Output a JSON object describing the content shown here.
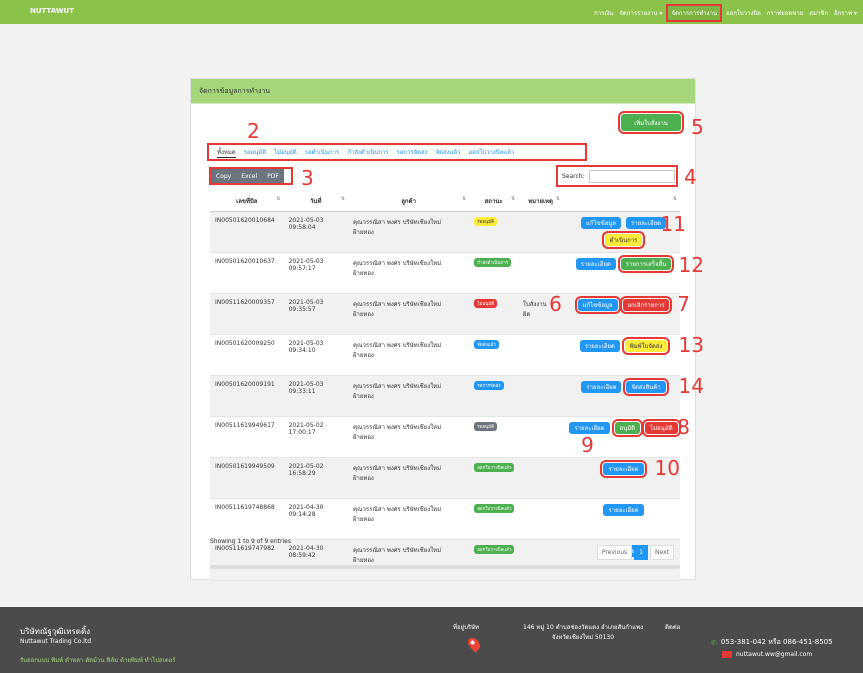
{
  "brand": "NUTTAWUT",
  "nav": [
    {
      "label": "การเงิน"
    },
    {
      "label": "จัดการรายงาน ▾"
    },
    {
      "label": "จัดการการทำงาน"
    },
    {
      "label": "ออกใบวางบิล"
    },
    {
      "label": "กราฟยอดขาย"
    },
    {
      "label": "สมาชิก"
    },
    {
      "label": "อีกราฟ ▾"
    }
  ],
  "card": {
    "title": "จัดการข้อมูลการทำงาน",
    "add_button": "เพิ่มใบสั่งงาน",
    "tabs": [
      "ทั้งหมด",
      "รออนุมัติ",
      "ไม่อนุมัติ",
      "รอดำเนินการ",
      "กำลังดำเนินการ",
      "รอการจัดส่ง",
      "จัดส่งแล้ว",
      "ออกใบวางบิลแล้ว"
    ],
    "export_buttons": [
      "Copy",
      "Excel",
      "PDF"
    ],
    "search_label": "Search:",
    "columns": [
      "เลขที่บิล",
      "วันที่",
      "ลูกค้า",
      "สถานะ",
      "หมายเหตุ",
      ""
    ],
    "rows": [
      {
        "bill": "IN00501620010684",
        "date1": "2021-05-03",
        "date2": "09:58:04",
        "customer": "คุณวรรณิสา พงศร บริษัทเชียงใหม่",
        "customer2": "ฝ้ายทอง",
        "status": "รออนุมัติ",
        "note": ""
      },
      {
        "bill": "IN00501620010637",
        "date1": "2021-05-03",
        "date2": "09:57:17",
        "customer": "คุณวรรณิสา พงศร บริษัทเชียงใหม่",
        "customer2": "ฝ้ายทอง",
        "status": "กำลังดำเนินการ",
        "note": ""
      },
      {
        "bill": "IN00511620009357",
        "date1": "2021-05-03",
        "date2": "09:35:57",
        "customer": "คุณวรรณิสา พงศร บริษัทเชียงใหม่",
        "customer2": "ฝ้ายทอง",
        "status": "ไม่อนุมัติ",
        "note": "ใบสั่งงาน",
        "note2": "ผิด"
      },
      {
        "bill": "IN00501620009250",
        "date1": "2021-05-03",
        "date2": "09:34:10",
        "customer": "คุณวรรณิสา พงศร บริษัทเชียงใหม่",
        "customer2": "ฝ้ายทอง",
        "status": "จัดส่งแล้ว",
        "note": ""
      },
      {
        "bill": "IN00501620009191",
        "date1": "2021-05-03",
        "date2": "09:33:11",
        "customer": "คุณวรรณิสา พงศร บริษัทเชียงใหม่",
        "customer2": "ฝ้ายทอง",
        "status": "รอการจัดส่ง",
        "note": ""
      },
      {
        "bill": "IN00511619949617",
        "date1": "2021-05-02",
        "date2": "17:00:17",
        "customer": "คุณวรรณิสา พงศร บริษัทเชียงใหม่",
        "customer2": "ฝ้ายทอง",
        "status": "รออนุมัติ",
        "note": ""
      },
      {
        "bill": "IN00501619949509",
        "date1": "2021-05-02",
        "date2": "16:58:29",
        "customer": "คุณวรรณิสา พงศร บริษัทเชียงใหม่",
        "customer2": "ฝ้ายทอง",
        "status": "ออกใบวางบิลแล้ว",
        "note": ""
      },
      {
        "bill": "IN00511619748868",
        "date1": "2021-04-30",
        "date2": "09:14:28",
        "customer": "คุณวรรณิสา พงศร บริษัทเชียงใหม่",
        "customer2": "ฝ้ายทอง",
        "status": "ออกใบวางบิลแล้ว",
        "note": ""
      },
      {
        "bill": "IN00511619747982",
        "date1": "2021-04-30",
        "date2": "08:59:42",
        "customer": "คุณวรรณิสา พงศร บริษัทเชียงใหม่",
        "customer2": "ฝ้ายทอง",
        "status": "ออกใบวางบิลแล้ว",
        "note": ""
      }
    ],
    "actions": {
      "edit": "แก้ไขข้อมูล",
      "details": "รายละเอียด",
      "process": "ดำเนินการ",
      "finished": "รายการเสร็จสิ้น",
      "cancel": "ยกเลิกรายการ",
      "print": "พิมพ์ใบจัดส่ง",
      "ship": "จัดส่งสินค้า",
      "approve": "อนุมัติ",
      "reject": "ไม่อนุมัติ"
    },
    "summary": "Showing 1 to 9 of 9 entries",
    "pager": [
      "Previous",
      "1",
      "Next"
    ]
  },
  "markers": [
    "1",
    "2",
    "3",
    "4",
    "5",
    "6",
    "7",
    "8",
    "9",
    "10",
    "11",
    "12",
    "13",
    "14"
  ],
  "footer": {
    "company": "บริษัทณัฐวุฒิเทรดดิ้ง",
    "company_en": "Nuttawut Trading Co.ltd",
    "services": "รับออกแบบ พิมพ์ ดำหลา ตัดม้วน ฟิล์ม ด้ายพิมพ์ ทำโปสเตอร์",
    "location_label": "ที่อยู่บริษัท",
    "address": "146 หมู่ 10 ตำบลช่องวัดแดง อำเภอสันกำแพง",
    "address2": "จังหวัดเชียงใหม่ 50130",
    "contact_label": "ติดต่อ",
    "phone": "053-381-042 หรือ 086-451-8505",
    "email": "nuttawut.ww@gmail.com"
  },
  "colors": {
    "nav": "#8bc34a",
    "header": "#a5d67a",
    "blue": "#2196f3",
    "red": "#e53935",
    "green": "#4caf50",
    "yellow": "#ffeb3b",
    "footer": "#4b4b4b"
  }
}
